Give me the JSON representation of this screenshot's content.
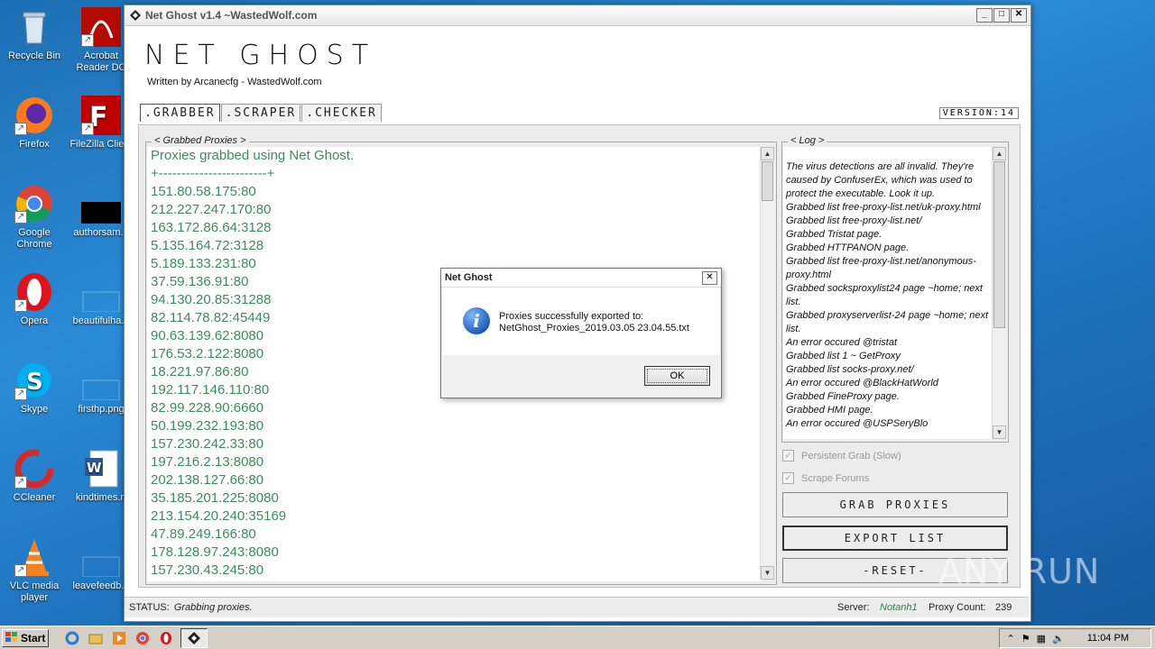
{
  "desktop": {
    "icons": [
      {
        "label": "Recycle Bin"
      },
      {
        "label": "Acrobat Reader DC"
      },
      {
        "label": "Firefox"
      },
      {
        "label": "FileZilla Client"
      },
      {
        "label": "Google Chrome"
      },
      {
        "label": "authorsam..."
      },
      {
        "label": "Opera"
      },
      {
        "label": "beautifulha..."
      },
      {
        "label": "Skype"
      },
      {
        "label": "firsthp.png"
      },
      {
        "label": "CCleaner"
      },
      {
        "label": "kindtimes.rt"
      },
      {
        "label": "VLC media player"
      },
      {
        "label": "leavefeedb..."
      }
    ]
  },
  "window": {
    "title": "Net Ghost v1.4 ~WastedWolf.com",
    "brand": "NET GHOST",
    "subtitle": "Written by Arcanecfg - WastedWolf.com",
    "tabs": [
      ".GRABBER",
      ".SCRAPER",
      ".CHECKER"
    ],
    "version": "VERSION:14"
  },
  "grabbed": {
    "legend": "< Grabbed Proxies >",
    "header": "Proxies grabbed using Net Ghost.",
    "separator": "+------------------------+",
    "proxies": [
      "151.80.58.175:80",
      "212.227.247.170:80",
      "163.172.86.64:3128",
      "5.135.164.72:3128",
      "5.189.133.231:80",
      "37.59.136.91:80",
      "94.130.20.85:31288",
      "82.114.78.82:45449",
      "90.63.139.62:8080",
      "176.53.2.122:8080",
      "18.221.97.86:80",
      "192.117.146.110:80",
      "82.99.228.90:6660",
      "50.199.232.193:80",
      "157.230.242.33:80",
      "197.216.2.13:8080",
      "202.138.127.66:80",
      "35.185.201.225:8080",
      "213.154.20.240:35169",
      "47.89.249.166:80",
      "178.128.97.243:8080",
      "157.230.43.245:80"
    ]
  },
  "log": {
    "legend": "< Log >",
    "lines": [
      "The virus detections are all invalid. They're caused by ConfuserEx, which was used to protect the executable. Look it up.",
      "Grabbed list free-proxy-list.net/uk-proxy.html",
      "Grabbed list free-proxy-list.net/",
      "Grabbed Tristat page.",
      "Grabbed HTTPANON page.",
      "Grabbed list free-proxy-list.net/anonymous-proxy.html",
      "Grabbed socksproxylist24 page ~home; next list.",
      "Grabbed proxyserverlist-24 page ~home; next list.",
      "An error occured @tristat",
      "Grabbed list 1 ~ GetProxy",
      "Grabbed list socks-proxy.net/",
      "An error occured @BlackHatWorld",
      "Grabbed FineProxy page.",
      "Grabbed HMI page.",
      "An error occured @USPSeryBlo"
    ]
  },
  "options": {
    "persistent": "Persistent Grab (Slow)",
    "scrape": "Scrape Forums"
  },
  "buttons": {
    "grab": "GRAB PROXIES",
    "export": "EXPORT LIST",
    "reset": "-RESET-"
  },
  "status": {
    "label": "STATUS:",
    "value": "Grabbing proxies.",
    "server_label": "Server:",
    "server_value": "Notanh1",
    "count_label": "Proxy Count:",
    "count_value": "239"
  },
  "dialog": {
    "title": "Net Ghost",
    "line1": "Proxies successfully exported to:",
    "line2": "NetGhost_Proxies_2019.03.05 23.04.55.txt",
    "ok": "OK"
  },
  "taskbar": {
    "start": "Start",
    "clock": "11:04 PM"
  },
  "watermark": "ANY RUN"
}
